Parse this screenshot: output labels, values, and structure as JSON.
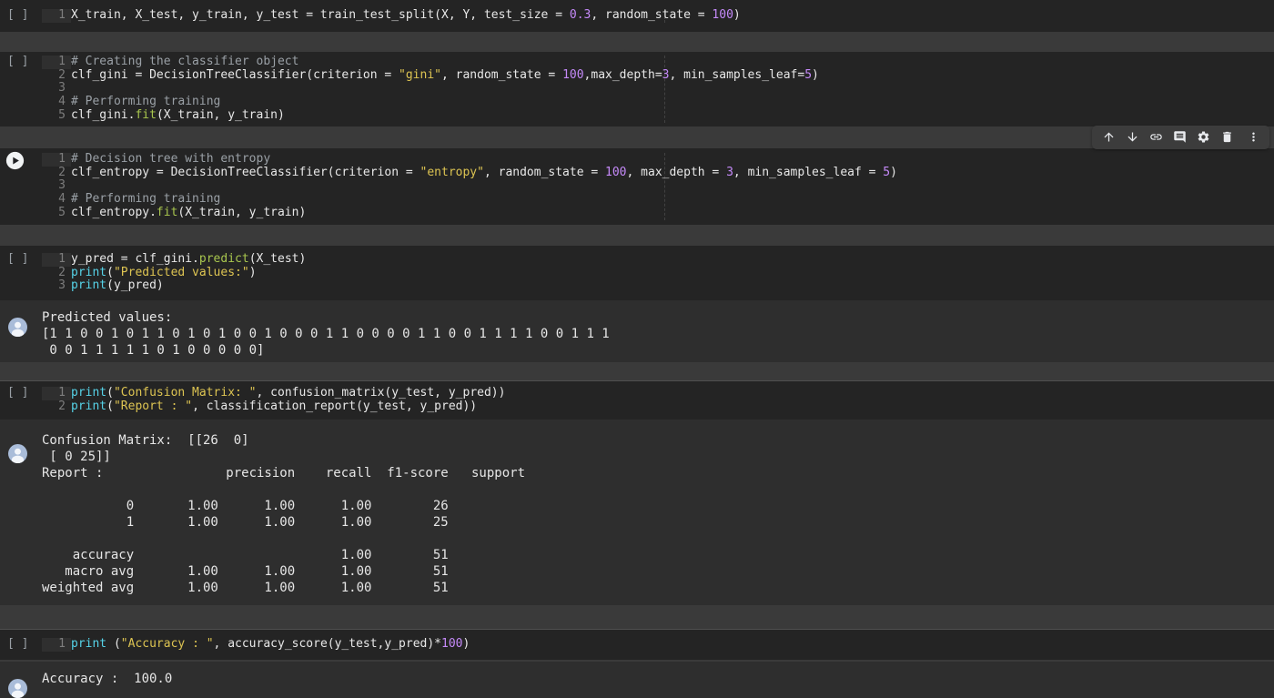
{
  "app": "notebook-editor",
  "colors": {
    "page_bg": "#3a3a3a",
    "code_bg": "#242424",
    "output_bg": "#2e2e2e",
    "token_plain": "#e8e8e8",
    "token_comment": "#9aa0a6",
    "token_string": "#ddc452",
    "token_number": "#c58af9",
    "token_function": "#a8c64e",
    "token_builtin": "#56d3e8",
    "line_number": "#7d7d7d",
    "line_highlight": "#2f2f2f",
    "bracket": "#9aa0a6",
    "output_text": "#e6e6e6",
    "avatar_bg": "#a9bcd9",
    "avatar_fg": "#f2f5fa",
    "play_bg": "#f1f3f4",
    "play_fg": "#202124",
    "toolbar_bg": "#3c3c3c",
    "toolbar_icon": "#e8eaed",
    "separator_line": "#4f4f4f",
    "ruler": "#5c5c5c"
  },
  "notebook": {
    "run_placeholder": "[ ]",
    "cell_toolbar": {
      "buttons": [
        {
          "button": "move-cell-up-button",
          "icon": "arrow-up-icon"
        },
        {
          "button": "move-cell-down-button",
          "icon": "arrow-down-icon"
        },
        {
          "button": "copy-cell-link-button",
          "icon": "link-icon"
        },
        {
          "button": "add-comment-button",
          "icon": "comment-icon"
        },
        {
          "button": "open-settings-button",
          "icon": "gear-icon"
        },
        {
          "button": "delete-cell-button",
          "icon": "trash-icon"
        },
        {
          "button": "more-actions-button",
          "icon": "kebab-menu-icon"
        }
      ]
    },
    "cells": [
      {
        "kind": "code",
        "marker": "brackets",
        "ruler": true,
        "gap_above": 0,
        "pad": [
          10,
          10
        ],
        "lines": [
          [
            [
              "p",
              "X_train, X_test, y_train, y_test = train_test_split(X, Y, test_size = "
            ],
            [
              "n",
              "0.3"
            ],
            [
              "p",
              ", random_state = "
            ],
            [
              "n",
              "100"
            ],
            [
              "p",
              ")"
            ]
          ]
        ]
      },
      {
        "kind": "code",
        "marker": "brackets",
        "ruler": true,
        "gap_above": 22,
        "pad": [
          4,
          4
        ],
        "lines": [
          [
            [
              "c",
              "# Creating the classifier object"
            ]
          ],
          [
            [
              "p",
              "clf_gini = DecisionTreeClassifier(criterion = "
            ],
            [
              "s",
              "\"gini\""
            ],
            [
              "p",
              ", random_state = "
            ],
            [
              "n",
              "100"
            ],
            [
              "p",
              ",max_depth="
            ],
            [
              "n",
              "3"
            ],
            [
              "p",
              ", min_samples_leaf="
            ],
            [
              "n",
              "5"
            ],
            [
              "p",
              ")"
            ]
          ],
          [],
          [
            [
              "c",
              "# Performing training"
            ]
          ],
          [
            [
              "p",
              "clf_gini."
            ],
            [
              "f",
              "fit"
            ],
            [
              "p",
              "(X_train, y_train)"
            ]
          ]
        ]
      },
      {
        "kind": "code",
        "marker": "play",
        "ruler": true,
        "toolbar": true,
        "gap_above": 24,
        "pad": [
          5,
          5
        ],
        "lines": [
          [
            [
              "c",
              "# Decision tree with entropy"
            ]
          ],
          [
            [
              "p",
              "clf_entropy = DecisionTreeClassifier(criterion = "
            ],
            [
              "s",
              "\"entropy\""
            ],
            [
              "p",
              ", random_state = "
            ],
            [
              "n",
              "100"
            ],
            [
              "p",
              ", max_depth = "
            ],
            [
              "n",
              "3"
            ],
            [
              "p",
              ", min_samples_leaf = "
            ],
            [
              "n",
              "5"
            ],
            [
              "p",
              ")"
            ]
          ],
          [],
          [
            [
              "c",
              "# Performing training"
            ]
          ],
          [
            [
              "p",
              "clf_entropy."
            ],
            [
              "f",
              "fit"
            ],
            [
              "p",
              "(X_train, y_train)"
            ]
          ]
        ]
      },
      {
        "kind": "code",
        "marker": "brackets",
        "ruler": false,
        "gap_above": 23,
        "pad": [
          8,
          8
        ],
        "lines": [
          [
            [
              "p",
              "y_pred = clf_gini."
            ],
            [
              "f",
              "predict"
            ],
            [
              "p",
              "(X_test)"
            ]
          ],
          [
            [
              "k",
              "print"
            ],
            [
              "p",
              "("
            ],
            [
              "s",
              "\"Predicted values:\""
            ],
            [
              "p",
              ")"
            ]
          ],
          [
            [
              "k",
              "print"
            ],
            [
              "p",
              "(y_pred)"
            ]
          ]
        ]
      },
      {
        "kind": "output",
        "gap_above": 0,
        "pad": [
          10,
          4
        ],
        "lines": [
          "Predicted values:",
          "[1 1 0 0 1 0 1 1 0 1 0 1 0 0 1 0 0 0 1 1 0 0 0 0 1 1 0 0 1 1 1 1 0 0 1 1 1",
          " 0 0 1 1 1 1 1 0 1 0 0 0 0 0]"
        ]
      },
      {
        "kind": "code",
        "marker": "brackets",
        "ruler": false,
        "gap_above": 20,
        "rule_above": true,
        "pad": [
          6,
          6
        ],
        "lines": [
          [
            [
              "k",
              "print"
            ],
            [
              "p",
              "("
            ],
            [
              "s",
              "\"Confusion Matrix: \""
            ],
            [
              "p",
              ", confusion_matrix(y_test, y_pred))"
            ]
          ],
          [
            [
              "k",
              "print"
            ],
            [
              "p",
              "("
            ],
            [
              "s",
              "\"Report : \""
            ],
            [
              "p",
              ", classification_report(y_test, y_pred))"
            ]
          ]
        ]
      },
      {
        "kind": "output",
        "gap_above": 0,
        "pad": [
          14,
          10
        ],
        "lines": [
          "Confusion Matrix:  [[26  0]",
          " [ 0 25]]",
          "Report :                precision    recall  f1-score   support",
          "",
          "           0       1.00      1.00      1.00        26",
          "           1       1.00      1.00      1.00        25",
          "",
          "    accuracy                           1.00        51",
          "   macro avg       1.00      1.00      1.00        51",
          "weighted avg       1.00      1.00      1.00        51"
        ]
      },
      {
        "kind": "code",
        "marker": "brackets",
        "ruler": false,
        "gap_above": 26,
        "rule_above": true,
        "pad": [
          9,
          9
        ],
        "lines": [
          [
            [
              "k",
              "print"
            ],
            [
              "p",
              " ("
            ],
            [
              "s",
              "\"Accuracy : \""
            ],
            [
              "p",
              ", accuracy_score(y_test,y_pred)*"
            ],
            [
              "n",
              "100"
            ],
            [
              "p",
              ")"
            ]
          ]
        ]
      },
      {
        "kind": "output",
        "gap_above": 2,
        "pad": [
          10,
          12
        ],
        "lines": [
          "Accuracy :  100.0"
        ]
      }
    ]
  }
}
